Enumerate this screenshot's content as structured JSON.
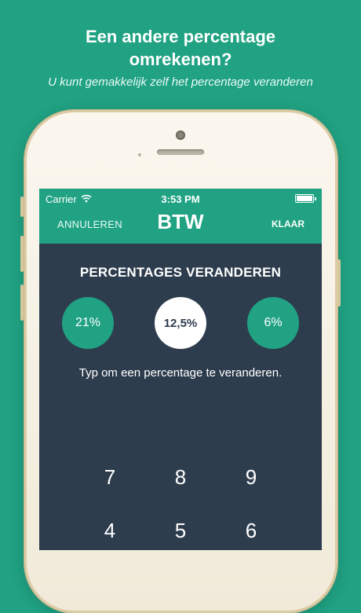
{
  "promo": {
    "headline_line1": "Een andere percentage",
    "headline_line2": "omrekenen?",
    "subtitle": "U kunt gemakkelijk zelf het percentage veranderen"
  },
  "status_bar": {
    "carrier": "Carrier",
    "time": "3:53 PM",
    "wifi_icon": "wifi-icon",
    "battery_icon": "battery-icon"
  },
  "nav": {
    "cancel_label": "ANNULEREN",
    "title": "BTW",
    "done_label": "KLAAR"
  },
  "content": {
    "section_title": "PERCENTAGES VERANDEREN",
    "percentages": [
      "21%",
      "12,5%",
      "6%"
    ],
    "selected_index": 1,
    "hint": "Typ om een percentage te veranderen."
  },
  "keypad": {
    "row1": [
      "7",
      "8",
      "9"
    ],
    "row2": [
      "4",
      "5",
      "6"
    ]
  },
  "colors": {
    "background": "#20a283",
    "screen": "#2e3d4e",
    "accent": "#20a283",
    "text_light": "#ffffff"
  }
}
